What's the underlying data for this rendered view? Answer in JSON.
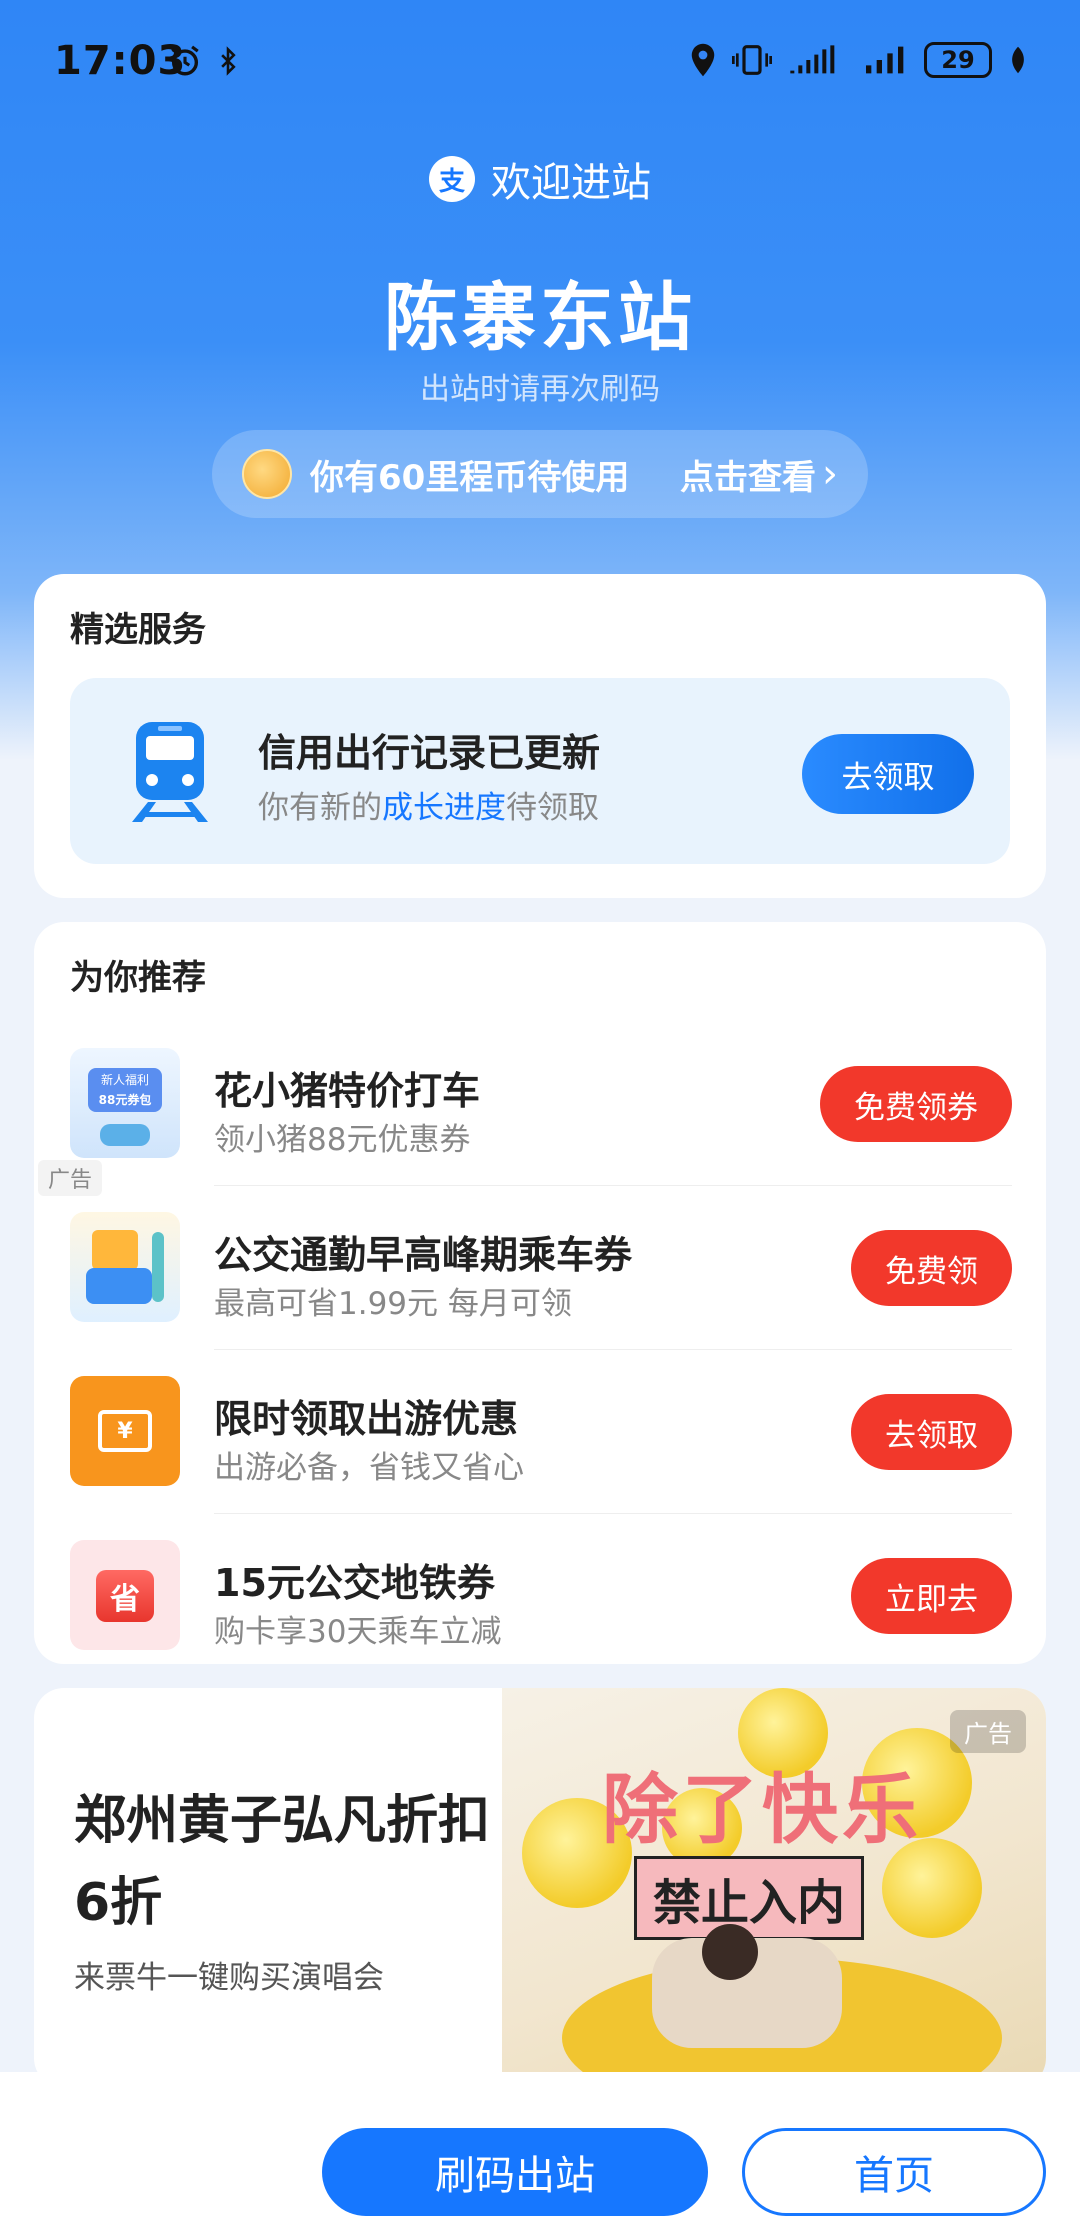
{
  "status_bar": {
    "time": "17:03",
    "battery": "29"
  },
  "header": {
    "welcome": "欢迎进站",
    "logo_char": "支",
    "station": "陈寨东站",
    "hint": "出站时请再次刷码",
    "mileage_text": "你有60里程币待使用",
    "mileage_link": "点击查看",
    "mileage_arrow": "›"
  },
  "services": {
    "title": "精选服务",
    "item": {
      "title": "信用出行记录已更新",
      "sub_prefix": "你有新的",
      "sub_highlight": "成长进度",
      "sub_suffix": "待领取",
      "button": "去领取"
    }
  },
  "recommend": {
    "title": "为你推荐",
    "items": [
      {
        "name": "花小猪特价打车",
        "desc": "领小猪88元优惠券",
        "button": "免费领券",
        "ad": "广告",
        "thumb_line1": "新人福利",
        "thumb_line2": "88元券包"
      },
      {
        "name": "公交通勤早高峰期乘车券",
        "desc": "最高可省1.99元 每月可领",
        "button": "免费领"
      },
      {
        "name": "限时领取出游优惠",
        "desc": "出游必备，省钱又省心",
        "button": "去领取",
        "thumb_glyph": "¥"
      },
      {
        "name": "15元公交地铁券",
        "desc": "购卡享30天乘车立减",
        "button": "立即去",
        "thumb_glyph": "省"
      }
    ]
  },
  "banner": {
    "title": "郑州黄子弘凡折扣6折",
    "subtitle": "来票牛一键购买演唱会",
    "poster_main": "除了快乐",
    "poster_sub": "禁止入内",
    "ad": "广告"
  },
  "bottom": {
    "primary": "刷码出站",
    "secondary": "首页"
  },
  "colors": {
    "brand": "#1677ff",
    "red": "#f2382b"
  }
}
